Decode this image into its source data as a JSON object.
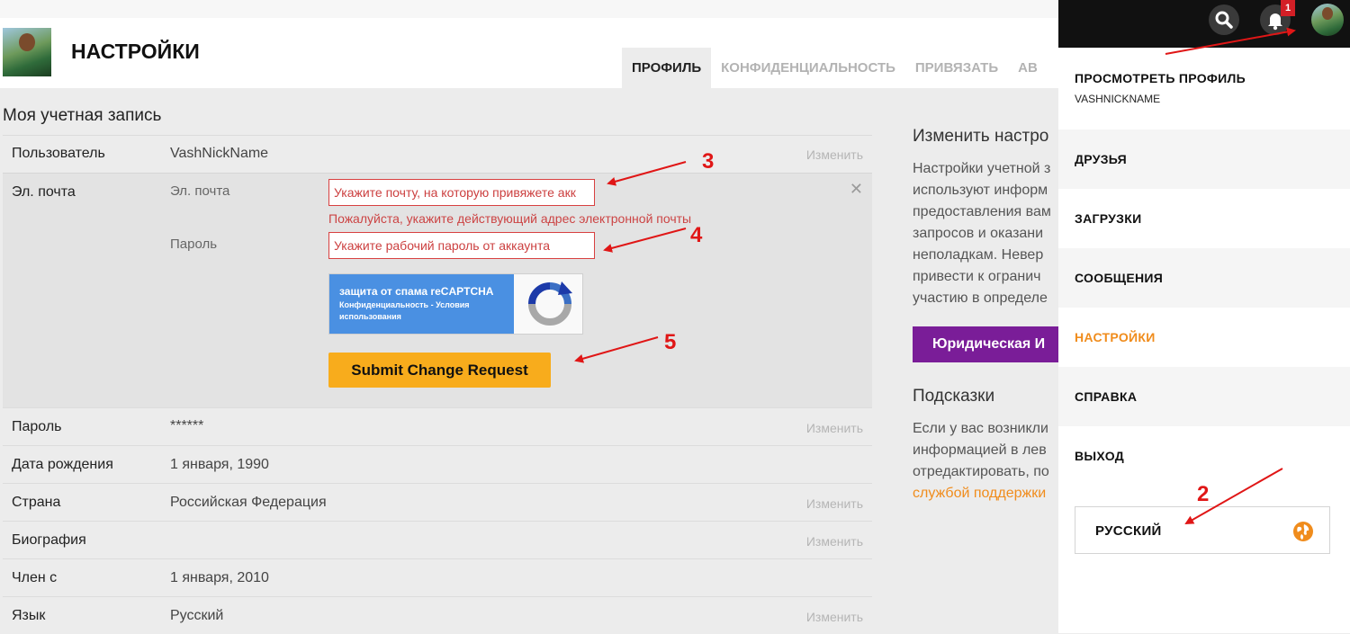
{
  "header": {
    "title": "НАСТРОЙКИ",
    "tabs": [
      "ПРОФИЛЬ",
      "КОНФИДЕНЦИАЛЬНОСТЬ",
      "ПРИВЯЗАТЬ",
      "АВ"
    ]
  },
  "account": {
    "section_title": "Моя учетная запись",
    "change_label": "Изменить",
    "user": {
      "label": "Пользователь",
      "value": "VashNickName"
    },
    "email": {
      "label": "Эл. почта",
      "email_label": "Эл. почта",
      "email_placeholder": "Укажите почту, на которую привяжете акк",
      "error": "Пожалуйста, укажите действующий адрес электронной почты",
      "password_label": "Пароль",
      "password_placeholder": "Укажите рабочий пароль от аккаунта",
      "close": "✕",
      "captcha_title": "защита от спама reCAPTCHA",
      "captcha_links": "Конфиденциальность - Условия использования",
      "submit": "Submit Change Request"
    },
    "rows": [
      {
        "label": "Пароль",
        "value": "******",
        "change": true
      },
      {
        "label": "Дата рождения",
        "value": "1 января, 1990",
        "change": false
      },
      {
        "label": "Страна",
        "value": "Российская Федерация",
        "change": true
      },
      {
        "label": "Биография",
        "value": "",
        "change": true
      },
      {
        "label": "Член с",
        "value": "1 января, 2010",
        "change": false
      },
      {
        "label": "Язык",
        "value": "Русский",
        "change": true
      }
    ]
  },
  "right": {
    "heading1": "Изменить настро",
    "para1": [
      "Настройки учетной з",
      "используют информ",
      "предоставления вам",
      "запросов и оказани",
      "неполадкам. Невер",
      "привести к огранич",
      "участию в определе"
    ],
    "legal_button": "Юридическая И",
    "heading2": "Подсказки",
    "para2": [
      "Если у вас возникли",
      "информацией в лев",
      "отредактировать, по"
    ],
    "support_link": "службой поддержки"
  },
  "topbar": {
    "notification_count": "1"
  },
  "dropdown": {
    "view_profile": "ПРОСМОТРЕТЬ ПРОФИЛЬ",
    "nickname": "VASHNICKNAME",
    "items": [
      "ДРУЗЬЯ",
      "ЗАГРУЗКИ",
      "СООБЩЕНИЯ",
      "НАСТРОЙКИ",
      "СПРАВКА",
      "ВЫХОД"
    ],
    "language": "РУССКИЙ"
  },
  "annotations": [
    "2",
    "3",
    "4",
    "5"
  ],
  "colors": {
    "accent": "#f08c1c",
    "submit": "#f8ac1c",
    "legal": "#7a1d98",
    "error": "#cc4444",
    "annotation": "#e01616"
  }
}
